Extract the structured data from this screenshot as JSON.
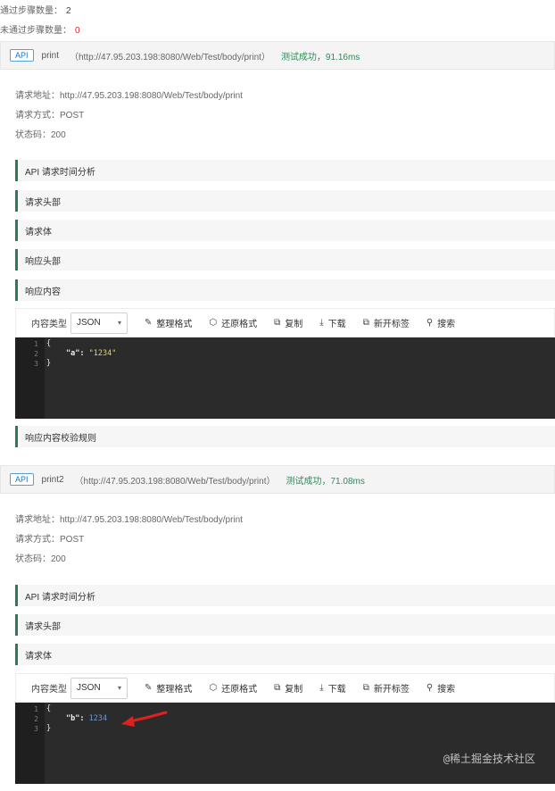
{
  "summary": {
    "passed_label": "通过步骤数量：",
    "passed_value": "2",
    "failed_label": "未通过步骤数量：",
    "failed_value": "0"
  },
  "apis": [
    {
      "badge": "API",
      "name": "print",
      "url": "（http://47.95.203.198:8080/Web/Test/body/print）",
      "result": "测试成功，91.16ms",
      "request_url_line": "请求地址：http://47.95.203.198:8080/Web/Test/body/print",
      "method_line": "请求方式：POST",
      "status_line": "状态码：200",
      "sections": [
        "API 请求时间分析",
        "请求头部",
        "请求体",
        "响应头部",
        "响应内容"
      ],
      "after_section": "响应内容校验规则",
      "code": {
        "line_numbers": [
          "1",
          "2",
          "3"
        ],
        "line1": "{",
        "key": "\"a\"",
        "colon": ": ",
        "value": "\"1234\"",
        "line3": "}"
      }
    },
    {
      "badge": "API",
      "name": "print2",
      "url": "（http://47.95.203.198:8080/Web/Test/body/print）",
      "result": "测试成功，71.08ms",
      "request_url_line": "请求地址：http://47.95.203.198:8080/Web/Test/body/print",
      "method_line": "请求方式：POST",
      "status_line": "状态码：200",
      "sections": [
        "API 请求时间分析",
        "请求头部",
        "请求体"
      ],
      "code": {
        "line_numbers": [
          "1",
          "2",
          "3"
        ],
        "line1": "{",
        "key": "\"b\"",
        "colon": ": ",
        "value": "1234",
        "line3": "}"
      }
    }
  ],
  "toolbar": {
    "content_type_label": "内容类型",
    "content_type_value": "JSON",
    "format_label": "整理格式",
    "restore_label": "还原格式",
    "copy_label": "复制",
    "download_label": "下载",
    "new_tab_label": "新开标签",
    "search_label": "搜索"
  },
  "icons": {
    "format": "wrench-icon",
    "restore": "cube-icon",
    "copy": "copy-icon",
    "download": "download-icon",
    "new_tab": "external-link-icon",
    "search": "search-icon"
  },
  "colors": {
    "success": "#2e8b57",
    "fail_count": "#e02020",
    "accent_bar": "#2f7a55",
    "badge": "#1a73c8",
    "arrow": "#e02020"
  },
  "watermark": "@稀土掘金技术社区"
}
